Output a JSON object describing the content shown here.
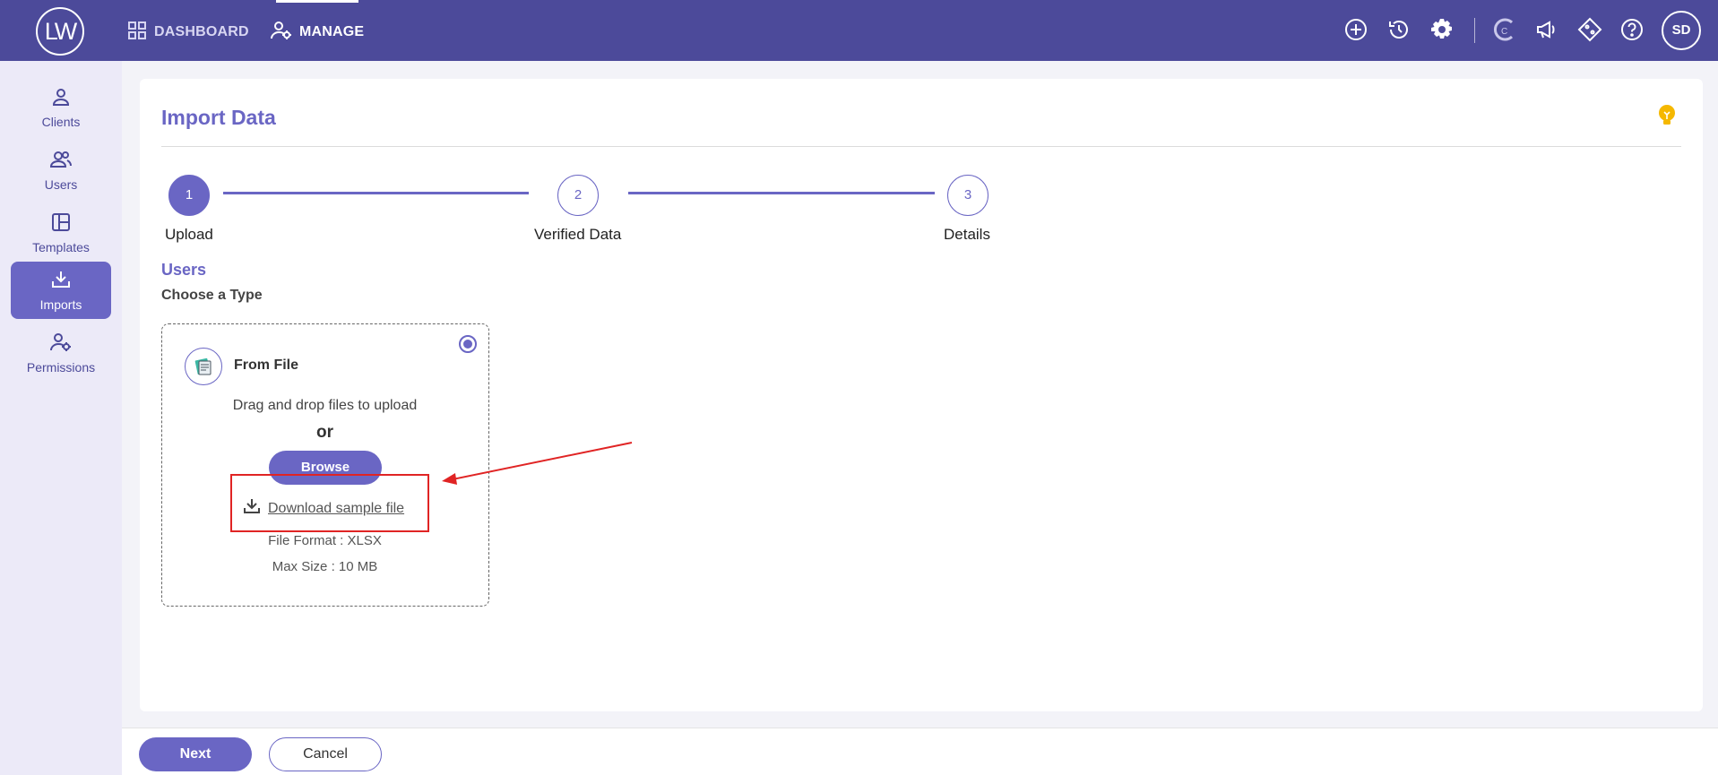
{
  "header": {
    "logo_text": "LW",
    "nav": [
      {
        "label": "DASHBOARD",
        "icon": "grid-icon",
        "active": false
      },
      {
        "label": "MANAGE",
        "icon": "user-gear-icon",
        "active": true
      }
    ],
    "right_icons": [
      "add-circle-icon",
      "history-icon",
      "settings-icon",
      "c-logo-icon",
      "megaphone-icon",
      "diamond-icon",
      "help-icon"
    ],
    "avatar_initials": "SD"
  },
  "sidebar": {
    "items": [
      {
        "label": "Clients",
        "icon": "person-icon",
        "active": false
      },
      {
        "label": "Users",
        "icon": "users-icon",
        "active": false
      },
      {
        "label": "Templates",
        "icon": "template-icon",
        "active": false
      },
      {
        "label": "Imports",
        "icon": "download-icon",
        "active": true
      },
      {
        "label": "Permissions",
        "icon": "user-gear-icon",
        "active": false
      }
    ]
  },
  "main": {
    "title": "Import Data",
    "steps": [
      {
        "number": "1",
        "label": "Upload",
        "active": true
      },
      {
        "number": "2",
        "label": "Verified Data",
        "active": false
      },
      {
        "number": "3",
        "label": "Details",
        "active": false
      }
    ],
    "section_heading": "Users",
    "section_subheading": "Choose a Type",
    "upload": {
      "title": "From File",
      "selected": true,
      "drag_text": "Drag and drop files to upload",
      "or_text": "or",
      "browse_label": "Browse",
      "download_label": "Download sample file",
      "file_format": "File Format : XLSX",
      "max_size": "Max Size : 10 MB"
    }
  },
  "footer": {
    "next_label": "Next",
    "cancel_label": "Cancel"
  },
  "colors": {
    "header_bg": "#4c4a9a",
    "accent": "#6a66c4",
    "sidebar_bg": "#eceaf8",
    "annotation_red": "#e02424",
    "bulb_yellow": "#f5b800"
  }
}
